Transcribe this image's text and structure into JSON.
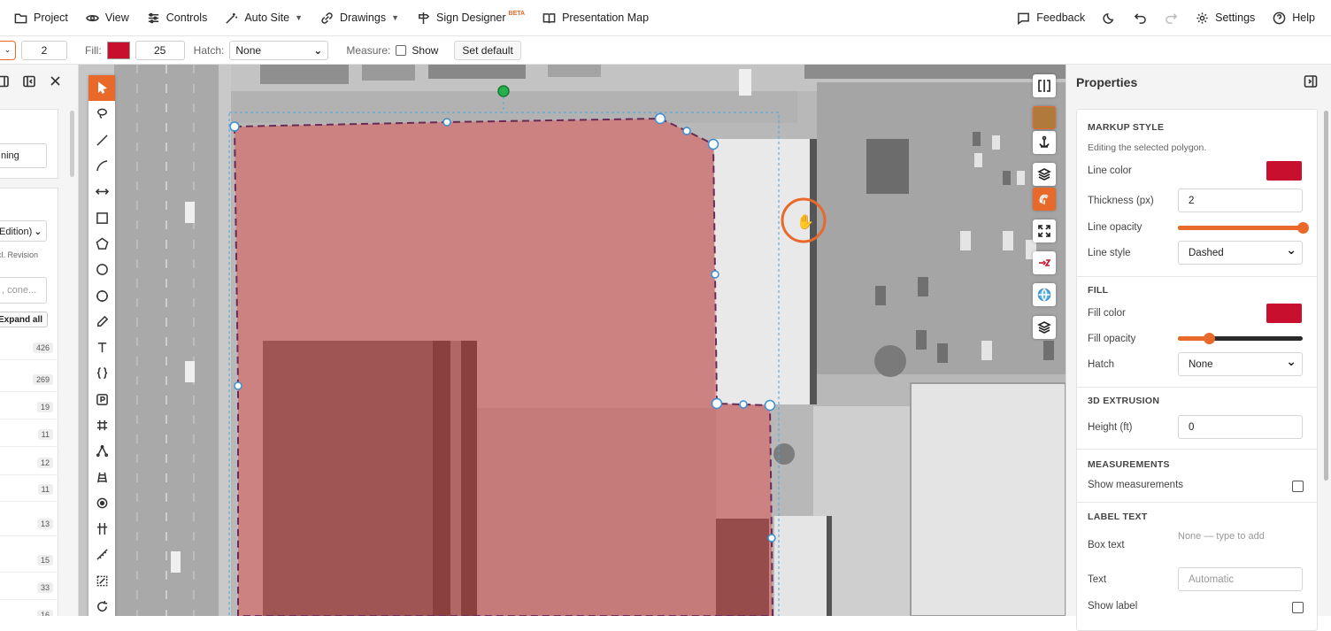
{
  "menu": {
    "project": "Project",
    "view": "View",
    "controls": "Controls",
    "auto_site": "Auto Site",
    "drawings": "Drawings",
    "sign_designer": "Sign Designer",
    "sign_designer_badge": "BETA",
    "presentation_map": "Presentation Map",
    "feedback": "Feedback",
    "settings": "Settings",
    "help": "Help"
  },
  "toolbar": {
    "thickness_value": "2",
    "fill_label": "Fill:",
    "fill_color": "#c8102e",
    "fill_value": "25",
    "hatch_label": "Hatch:",
    "hatch_value": "None",
    "measure_label": "Measure:",
    "show_label": "Show",
    "set_default_label": "Set default"
  },
  "left_panel": {
    "field_text": "ning",
    "select_text": "Edition)",
    "note_text": "cl. Revision",
    "search_placeholder": ", cone...",
    "expand_all": "Expand all",
    "counts": [
      "426",
      "269",
      "19",
      "11",
      "12",
      "11",
      "13",
      "15",
      "33",
      "16"
    ]
  },
  "map_tools": [
    "select",
    "lasso",
    "line",
    "arc",
    "dimension",
    "rectangle",
    "polygon",
    "circle",
    "ellipse",
    "pencil",
    "text",
    "callout",
    "parking",
    "grid",
    "node-edit",
    "ladder",
    "target",
    "column",
    "ruler",
    "crop",
    "rotate"
  ],
  "map_controls": [
    "swipe",
    "basemap-thumb",
    "anchor",
    "layers",
    "fingerprint",
    "fit-bounds",
    "north-compass",
    "globe",
    "layers-alt"
  ],
  "properties": {
    "title": "Properties",
    "markup_style": {
      "title": "MARKUP STYLE",
      "note": "Editing the selected polygon.",
      "line_color_label": "Line color",
      "line_color": "#c8102e",
      "thickness_label": "Thickness (px)",
      "thickness_value": "2",
      "line_opacity_label": "Line opacity",
      "line_opacity": 1.0,
      "line_style_label": "Line style",
      "line_style_value": "Dashed"
    },
    "fill": {
      "title": "FILL",
      "fill_color_label": "Fill color",
      "fill_color": "#c8102e",
      "fill_opacity_label": "Fill opacity",
      "fill_opacity": 0.25,
      "hatch_label": "Hatch",
      "hatch_value": "None"
    },
    "extrusion": {
      "title": "3D EXTRUSION",
      "height_label": "Height (ft)",
      "height_value": "0"
    },
    "measurements": {
      "title": "MEASUREMENTS",
      "show_label": "Show measurements"
    },
    "label_text": {
      "title": "LABEL TEXT",
      "box_text_label": "Box text",
      "box_text_placeholder": "None — type to add",
      "text_label": "Text",
      "text_placeholder": "Automatic",
      "show_label_label": "Show label"
    }
  }
}
